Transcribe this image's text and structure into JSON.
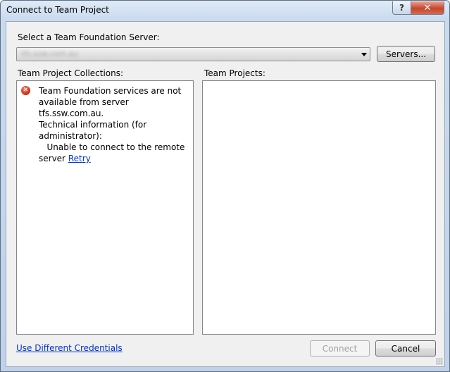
{
  "window": {
    "title": "Connect to Team Project",
    "help_label": "?",
    "close_label": "✕"
  },
  "server": {
    "label": "Select a Team Foundation Server:",
    "selected_value": "tfs.ssw.com.au",
    "servers_button": "Servers..."
  },
  "collections": {
    "label": "Team Project Collections:",
    "error_lines": "Team Foundation services are not\navailable from server tfs.ssw.com.au.\nTechnical information (for\nadministrator):\n   Unable to connect to the remote\nserver ",
    "retry_link": "Retry"
  },
  "projects": {
    "label": "Team Projects:"
  },
  "footer": {
    "credentials_link": "Use Different Credentials",
    "connect_button": "Connect",
    "cancel_button": "Cancel"
  },
  "icons": {
    "error": "error-icon",
    "dropdown": "chevron-down-icon"
  },
  "colors": {
    "link": "#0033cc",
    "error_icon": "#d4301a",
    "close_button": "#c7452c"
  }
}
